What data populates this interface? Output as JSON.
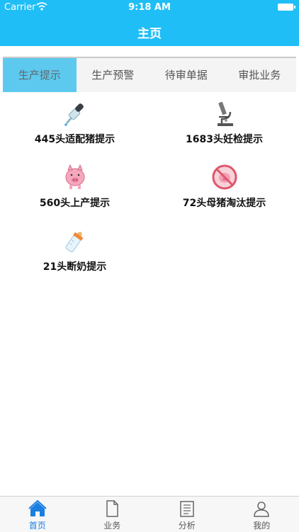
{
  "status_bar": {
    "carrier": "Carrier",
    "time": "9:18 AM"
  },
  "header": {
    "title": "主页"
  },
  "tabs": [
    {
      "label": "生产提示",
      "active": true
    },
    {
      "label": "生产预警",
      "active": false
    },
    {
      "label": "待审单据",
      "active": false
    },
    {
      "label": "审批业务",
      "active": false
    }
  ],
  "items": [
    {
      "label": "445头适配猪提示",
      "icon": "dropper-icon"
    },
    {
      "label": "1683头妊检提示",
      "icon": "microscope-icon"
    },
    {
      "label": "560头上产提示",
      "icon": "pig-icon"
    },
    {
      "label": "72头母猪淘汰提示",
      "icon": "cull-pig-icon"
    },
    {
      "label": "21头断奶提示",
      "icon": "bottle-icon"
    }
  ],
  "tabbar": [
    {
      "label": "首页",
      "icon": "home-icon",
      "active": true
    },
    {
      "label": "业务",
      "icon": "document-icon",
      "active": false
    },
    {
      "label": "分析",
      "icon": "analysis-icon",
      "active": false
    },
    {
      "label": "我的",
      "icon": "profile-icon",
      "active": false
    }
  ],
  "colors": {
    "header": "#1fbef6",
    "active_tab": "#5dc9ee",
    "tabbar_active": "#1a7fe0"
  }
}
